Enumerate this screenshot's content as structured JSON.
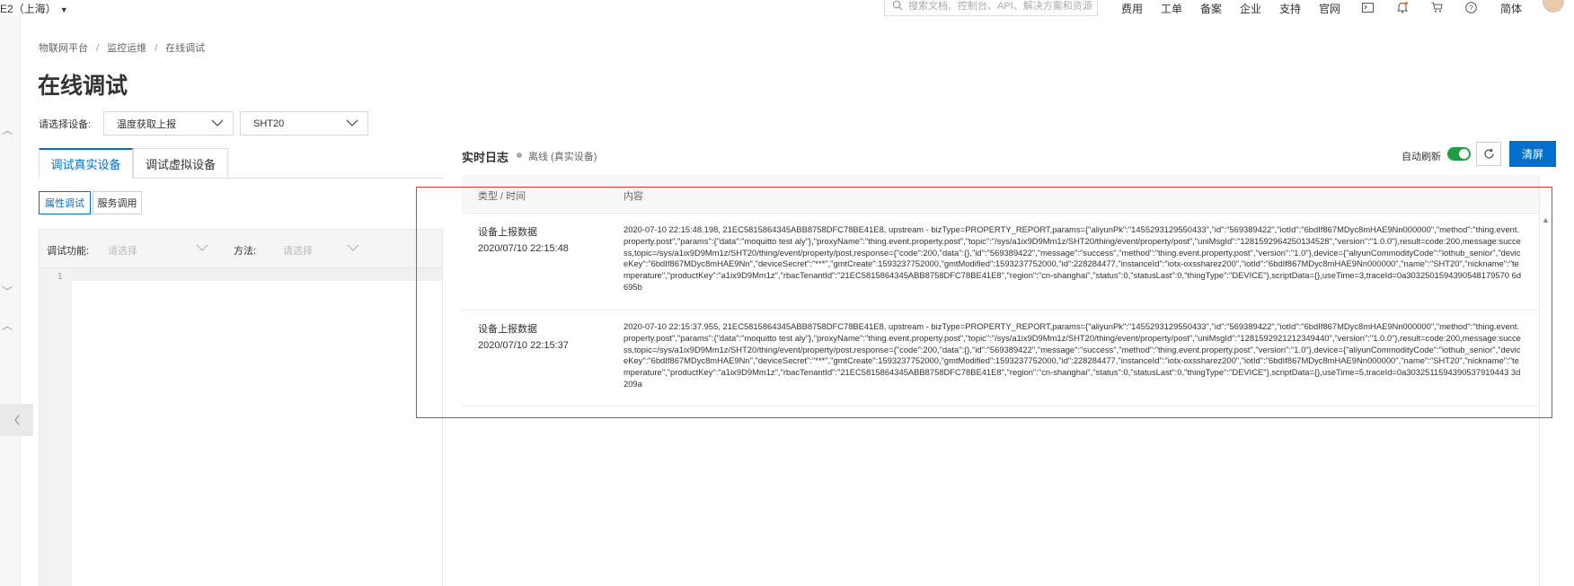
{
  "topbar": {
    "region": "E2（上海）",
    "search_placeholder": "搜索文档、控制台、API、解决方案和资源",
    "nav": [
      "费用",
      "工单",
      "备案",
      "企业",
      "支持",
      "官网"
    ],
    "lang": "简体"
  },
  "breadcrumb": [
    "物联网平台",
    "监控运维",
    "在线调试"
  ],
  "page_title": "在线调试",
  "device_select": {
    "label": "请选择设备:",
    "product": "温度获取上报",
    "device": "SHT20"
  },
  "tabs": [
    "调试真实设备",
    "调试虚拟设备"
  ],
  "subtabs": [
    "属性调试",
    "服务调用"
  ],
  "debug": {
    "function_label": "调试功能:",
    "function_placeholder": "请选择",
    "method_label": "方法:",
    "method_placeholder": "请选择",
    "line_number": "1"
  },
  "log": {
    "title": "实时日志",
    "status": "离线 (真实设备)",
    "status_color": "#aaaaaa",
    "auto_refresh_label": "自动刷新",
    "auto_refresh_on": true,
    "clear_label": "清屏",
    "col_type_time": "类型 / 时间",
    "col_content": "内容",
    "rows": [
      {
        "type": "设备上报数据",
        "time": "2020/07/10 22:15:48",
        "content": "2020-07-10 22:15:48.198, 21EC5815864345ABB8758DFC78BE41E8, upstream - bizType=PROPERTY_REPORT,params={\"aliyunPk\":\"1455293129550433\",\"id\":\"569389422\",\"iotId\":\"6bdIf867MDyc8mHAE9Nn000000\",\"method\":\"thing.event.property.post\",\"params\":{\"data\":\"moquitto test aly\"},\"proxyName\":\"thing.event.property.post\",\"topic\":\"/sys/a1ix9D9Mm1z/SHT20/thing/event/property/post\",\"uniMsgId\":\"1281592964250134528\",\"version\":\"1.0.0\"},result=code:200,message:success,topic=/sys/a1ix9D9Mm1z/SHT20/thing/event/property/post,response={\"code\":200,\"data\":{},\"id\":\"569389422\",\"message\":\"success\",\"method\":\"thing.event.property.post\",\"version\":\"1.0\"},device={\"aliyunCommodityCode\":\"iothub_senior\",\"deviceKey\":\"6bdIf867MDyc8mHAE9Nn\",\"deviceSecret\":\"***\",\"gmtCreate\":1593237752000,\"gmtModified\":1593237752000,\"id\":228284477,\"instanceId\":\"iotx-oxssharez200\",\"iotId\":\"6bdIf867MDyc8mHAE9Nn000000\",\"name\":\"SHT20\",\"nickname\":\"temperature\",\"productKey\":\"a1ix9D9Mm1z\",\"rbacTenantId\":\"21EC5815864345ABB8758DFC78BE41E8\",\"region\":\"cn-shanghai\",\"status\":0,\"statusLast\":0,\"thingType\":\"DEVICE\"},scriptData={},useTime=3,traceId=0a3032501594390548179570 6d695b"
      },
      {
        "type": "设备上报数据",
        "time": "2020/07/10 22:15:37",
        "content": "2020-07-10 22:15:37.955, 21EC5815864345ABB8758DFC78BE41E8, upstream - bizType=PROPERTY_REPORT,params={\"aliyunPk\":\"1455293129550433\",\"id\":\"569389422\",\"iotId\":\"6bdIf867MDyc8mHAE9Nn000000\",\"method\":\"thing.event.property.post\",\"params\":{\"data\":\"moquitto test aly\"},\"proxyName\":\"thing.event.property.post\",\"topic\":\"/sys/a1ix9D9Mm1z/SHT20/thing/event/property/post\",\"uniMsgId\":\"1281592921212349440\",\"version\":\"1.0.0\"},result=code:200,message:success,topic=/sys/a1ix9D9Mm1z/SHT20/thing/event/property/post,response={\"code\":200,\"data\":{},\"id\":\"569389422\",\"message\":\"success\",\"method\":\"thing.event.property.post\",\"version\":\"1.0\"},device={\"aliyunCommodityCode\":\"iothub_senior\",\"deviceKey\":\"6bdIf867MDyc8mHAE9Nn\",\"deviceSecret\":\"***\",\"gmtCreate\":1593237752000,\"gmtModified\":1593237752000,\"id\":228284477,\"instanceId\":\"iotx-oxssharez200\",\"iotId\":\"6bdIf867MDyc8mHAE9Nn000000\",\"name\":\"SHT20\",\"nickname\":\"temperature\",\"productKey\":\"a1ix9D9Mm1z\",\"rbacTenantId\":\"21EC5815864345ABB8758DFC78BE41E8\",\"region\":\"cn-shanghai\",\"status\":0,\"statusLast\":0,\"thingType\":\"DEVICE\"},scriptData={},useTime=5,traceId=0a3032511594390537919443 3d209a"
      }
    ]
  },
  "colors": {
    "primary": "#0070cc",
    "toggle_on": "#1e9e3e",
    "highlight": "#e03a3a"
  }
}
